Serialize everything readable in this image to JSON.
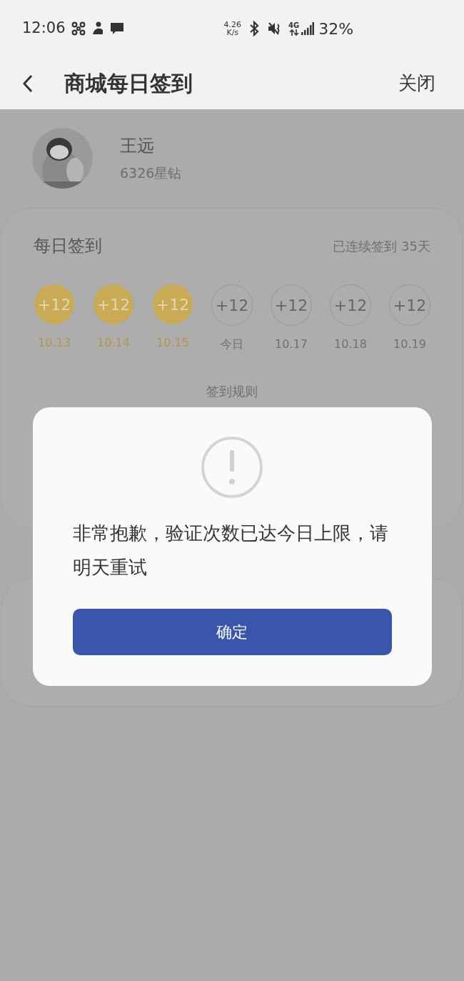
{
  "status_bar": {
    "time": "12:06",
    "net_speed": "4.26",
    "net_unit": "K/s",
    "network": "4G",
    "battery": "32%"
  },
  "header": {
    "title": "商城每日签到",
    "close": "关闭"
  },
  "profile": {
    "name": "王远",
    "points": "6326星钻"
  },
  "checkin": {
    "title": "每日签到",
    "streak": "已连续签到 35天",
    "days": [
      {
        "reward": "+12",
        "date": "10.13",
        "signed": true
      },
      {
        "reward": "+12",
        "date": "10.14",
        "signed": true
      },
      {
        "reward": "+12",
        "date": "10.15",
        "signed": true
      },
      {
        "reward": "+12",
        "date": "今日",
        "signed": false
      },
      {
        "reward": "+12",
        "date": "10.17",
        "signed": false
      },
      {
        "reward": "+12",
        "date": "10.18",
        "signed": false
      },
      {
        "reward": "+12",
        "date": "10.19",
        "signed": false
      }
    ],
    "rules": "签到规则"
  },
  "dialog": {
    "message": "非常抱歉，验证次数已达今日上限，请明天重试",
    "confirm": "确定"
  }
}
